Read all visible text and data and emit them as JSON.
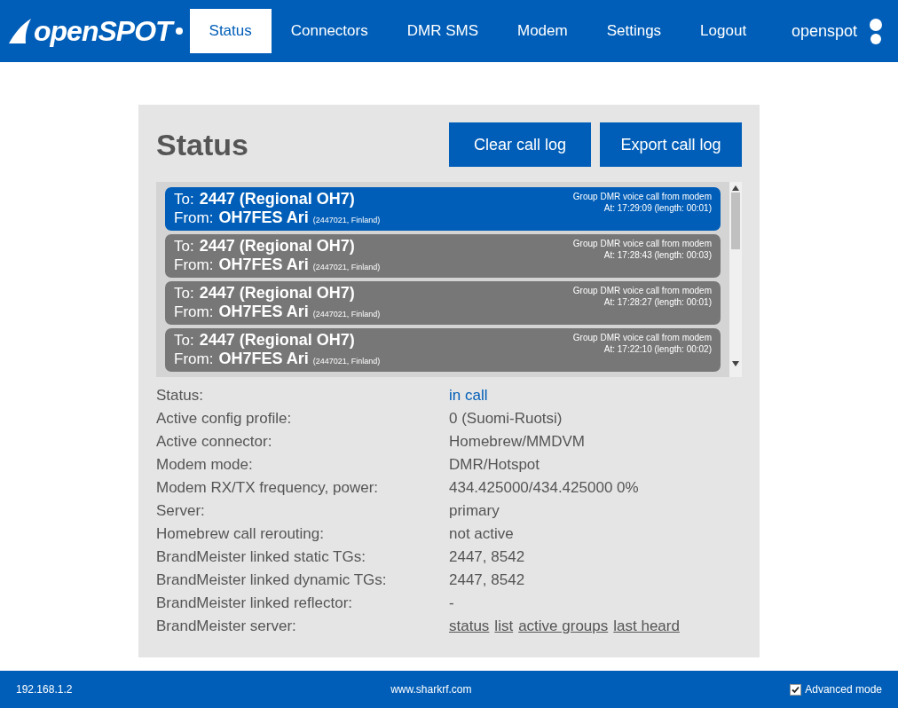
{
  "header": {
    "logo": "openSPOT",
    "tabs": [
      {
        "label": "Status",
        "selected": true
      },
      {
        "label": "Connectors",
        "selected": false
      },
      {
        "label": "DMR SMS",
        "selected": false
      },
      {
        "label": "Modem",
        "selected": false
      },
      {
        "label": "Settings",
        "selected": false
      },
      {
        "label": "Logout",
        "selected": false
      }
    ],
    "device_name": "openspot"
  },
  "panel": {
    "title": "Status",
    "buttons": [
      "Clear call log",
      "Export call log"
    ],
    "calls": [
      {
        "to_label": "To:",
        "to": "2447 (Regional OH7)",
        "from_label": "From:",
        "from": "OH7FES Ari",
        "from_detail": "(2447021, Finland)",
        "type": "Group DMR voice call from modem",
        "time": "At: 17:29:09 (length: 00:01)",
        "selected": true
      },
      {
        "to_label": "To:",
        "to": "2447 (Regional OH7)",
        "from_label": "From:",
        "from": "OH7FES Ari",
        "from_detail": "(2447021, Finland)",
        "type": "Group DMR voice call from modem",
        "time": "At: 17:28:43 (length: 00:03)",
        "selected": false
      },
      {
        "to_label": "To:",
        "to": "2447 (Regional OH7)",
        "from_label": "From:",
        "from": "OH7FES Ari",
        "from_detail": "(2447021, Finland)",
        "type": "Group DMR voice call from modem",
        "time": "At: 17:28:27 (length: 00:01)",
        "selected": false
      },
      {
        "to_label": "To:",
        "to": "2447 (Regional OH7)",
        "from_label": "From:",
        "from": "OH7FES Ari",
        "from_detail": "(2447021, Finland)",
        "type": "Group DMR voice call from modem",
        "time": "At: 17:22:10 (length: 00:02)",
        "selected": false
      }
    ],
    "info": [
      {
        "label": "Status:",
        "kind": "status",
        "value": "in call"
      },
      {
        "label": "Active config profile:",
        "kind": "text",
        "value": "0 (Suomi-Ruotsi)"
      },
      {
        "label": "Active connector:",
        "kind": "text",
        "value": "Homebrew/MMDVM"
      },
      {
        "label": "Modem mode:",
        "kind": "text",
        "value": "DMR/Hotspot"
      },
      {
        "label": "Modem RX/TX frequency, power:",
        "kind": "text",
        "value": "434.425000/434.425000 0%"
      },
      {
        "label": "Server:",
        "kind": "text",
        "value": "primary"
      },
      {
        "label": "Homebrew call rerouting:",
        "kind": "text",
        "value": "not active"
      },
      {
        "label": "BrandMeister linked static TGs:",
        "kind": "text",
        "value": "2447, 8542"
      },
      {
        "label": "BrandMeister linked dynamic TGs:",
        "kind": "text",
        "value": "2447, 8542"
      },
      {
        "label": "BrandMeister linked reflector:",
        "kind": "text",
        "value": "-"
      },
      {
        "label": "BrandMeister server:",
        "kind": "links",
        "links": [
          "status",
          "list",
          "active groups",
          "last heard"
        ]
      }
    ]
  },
  "footer": {
    "ip": "192.168.1.2",
    "website": "www.sharkrf.com",
    "advanced_mode": {
      "label": "Advanced mode",
      "checked": true
    }
  }
}
